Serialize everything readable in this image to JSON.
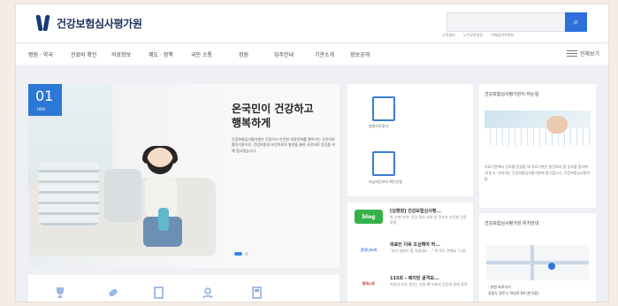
{
  "header": {
    "logo_text": "건강보험심사평가원",
    "search_button_icon": "search-icon",
    "top_links": [
      "고객센터",
      "노인요양병원",
      "약제급여목록표"
    ]
  },
  "gnb": {
    "items": [
      "병원 · 약국",
      "진료비 확인",
      "의료정보",
      "제도 · 정책",
      "국민 소통",
      "정원",
      "입주안내",
      "기관소개",
      "정보공개"
    ],
    "all_menu_label": "전체보기"
  },
  "hero": {
    "number": "01",
    "badge_sub": "HIRA",
    "title_line1": "온국민이 건강하고",
    "title_line2": "행복하게",
    "description": "건강보험심사평가원은 건강하고 안전한 의료문화를 열어가는 국민의료평가기관으로, 건강보험과 보건의료의 발전을 통한 국민의료 증진을 위해 힘쓰겠습니다."
  },
  "services": [
    {
      "label": "병원약국찾기",
      "icon": "hospital-search-icon"
    },
    {
      "label": "비급여진료비 확인신청",
      "icon": "receipt-check-icon"
    }
  ],
  "news": [
    {
      "logo": "blog",
      "title": "[심평원] 건강보험심사평...",
      "desc": "한 눈에 쏙쏙! 건강 정보 요약 한 정보가 가득한 건강보험"
    },
    {
      "logo": "건강나누리",
      "title": "의료인 더욱 조심해야 하...",
      "desc": "\"의사 설명이 좀 어렵네요 ...\" 목 적도 편해요 \"다음"
    },
    {
      "logo": "팟캐스트",
      "title": "115회 - 제지방 골격보...",
      "desc": "지방과 지지 생기는 방송 뼈 조향과 운동에 관해 알려"
    }
  ],
  "intro_card": {
    "title": "건강보험심사평가원이 하는일",
    "desc": "의료기관에서 진료를 받았을 때 의료기관은 총진료비 중 일부를 환자에게 받고, 나머지는 건강보험심사평가원에 청구합니다. 건강보험심사평가원"
  },
  "map_card": {
    "title": "건강보험심사평가원 위치안내",
    "line1": "· 본원 바로가기",
    "line2": "강원도 원주시 혁신로 60 (반곡동)"
  }
}
